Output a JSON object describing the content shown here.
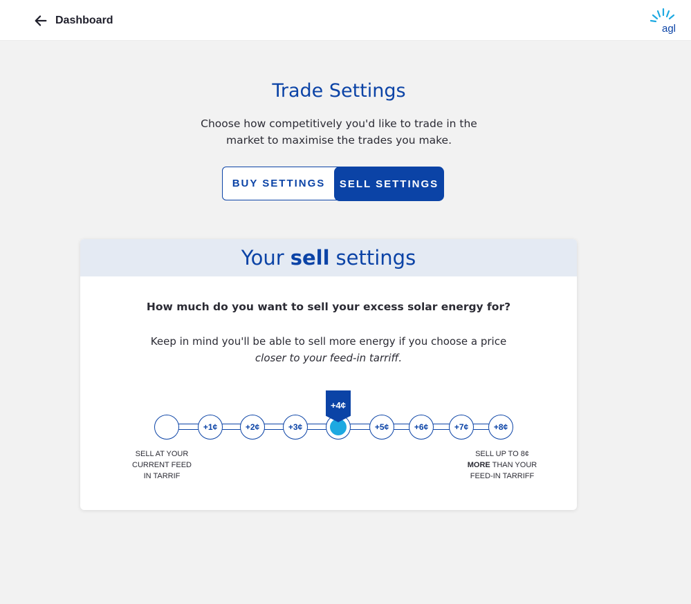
{
  "header": {
    "back_label": "Dashboard",
    "back_icon": "arrow-left-icon",
    "logo_text": "agl",
    "logo_colors": [
      "#1da9e1",
      "#0b43a6"
    ]
  },
  "page": {
    "title": "Trade Settings",
    "intro": "Choose how competitively you'd like to trade in the market to maximise the trades you make."
  },
  "toggle": {
    "buy_label": "BUY SETTINGS",
    "sell_label": "SELL SETTINGS",
    "selected": "sell"
  },
  "card": {
    "heading_pre": "Your",
    "heading_bold": "sell",
    "heading_post": "settings",
    "question": "How much do you want to sell your excess solar energy for?",
    "note_line1": "Keep in mind you'll be able to sell more energy if you choose a price",
    "note_line2": "closer to your feed-in tarriff."
  },
  "slider": {
    "stops": [
      "",
      "+1¢",
      "+2¢",
      "+3¢",
      "+4¢",
      "+5¢",
      "+6¢",
      "+7¢",
      "+8¢"
    ],
    "selected_index": 4,
    "selected_label": "+4¢",
    "left_caption": [
      "SELL AT YOUR",
      "CURRENT FEED",
      "IN TARRIF"
    ],
    "right_caption_line1": "SELL UP TO 8¢",
    "right_caption_bold": "MORE",
    "right_caption_line2_rest": " THAN YOUR",
    "right_caption_line3": "FEED-IN TARRIFF"
  },
  "colors": {
    "primary": "#0b43a6",
    "accent": "#1da9e1",
    "header_band": "#e4eaf3",
    "page_bg": "#f2f2f2"
  }
}
